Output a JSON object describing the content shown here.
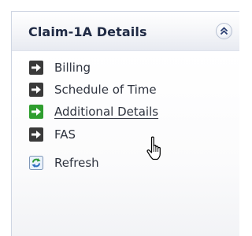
{
  "panel": {
    "title": "Claim-1A Details",
    "collapse_icon": "double-chevron-up-icon"
  },
  "items": [
    {
      "label": "Billing",
      "icon": "arrow-right-icon",
      "icon_color": "#3a3a3a"
    },
    {
      "label": "Schedule of Time",
      "icon": "arrow-right-icon",
      "icon_color": "#3a3a3a"
    },
    {
      "label": "Additional Details",
      "icon": "arrow-right-icon",
      "icon_color": "#2f9e2f",
      "hovered": true
    },
    {
      "label": "FAS",
      "icon": "arrow-right-icon",
      "icon_color": "#3a3a3a"
    }
  ],
  "refresh": {
    "label": "Refresh",
    "icon": "refresh-icon"
  },
  "colors": {
    "title_text": "#1f2a44",
    "item_text": "#2f3440",
    "panel_border": "#cfd6e3",
    "arrow_dark": "#3a3a3a",
    "arrow_active": "#2f9e2f"
  },
  "cursor": "hand-pointer-icon"
}
